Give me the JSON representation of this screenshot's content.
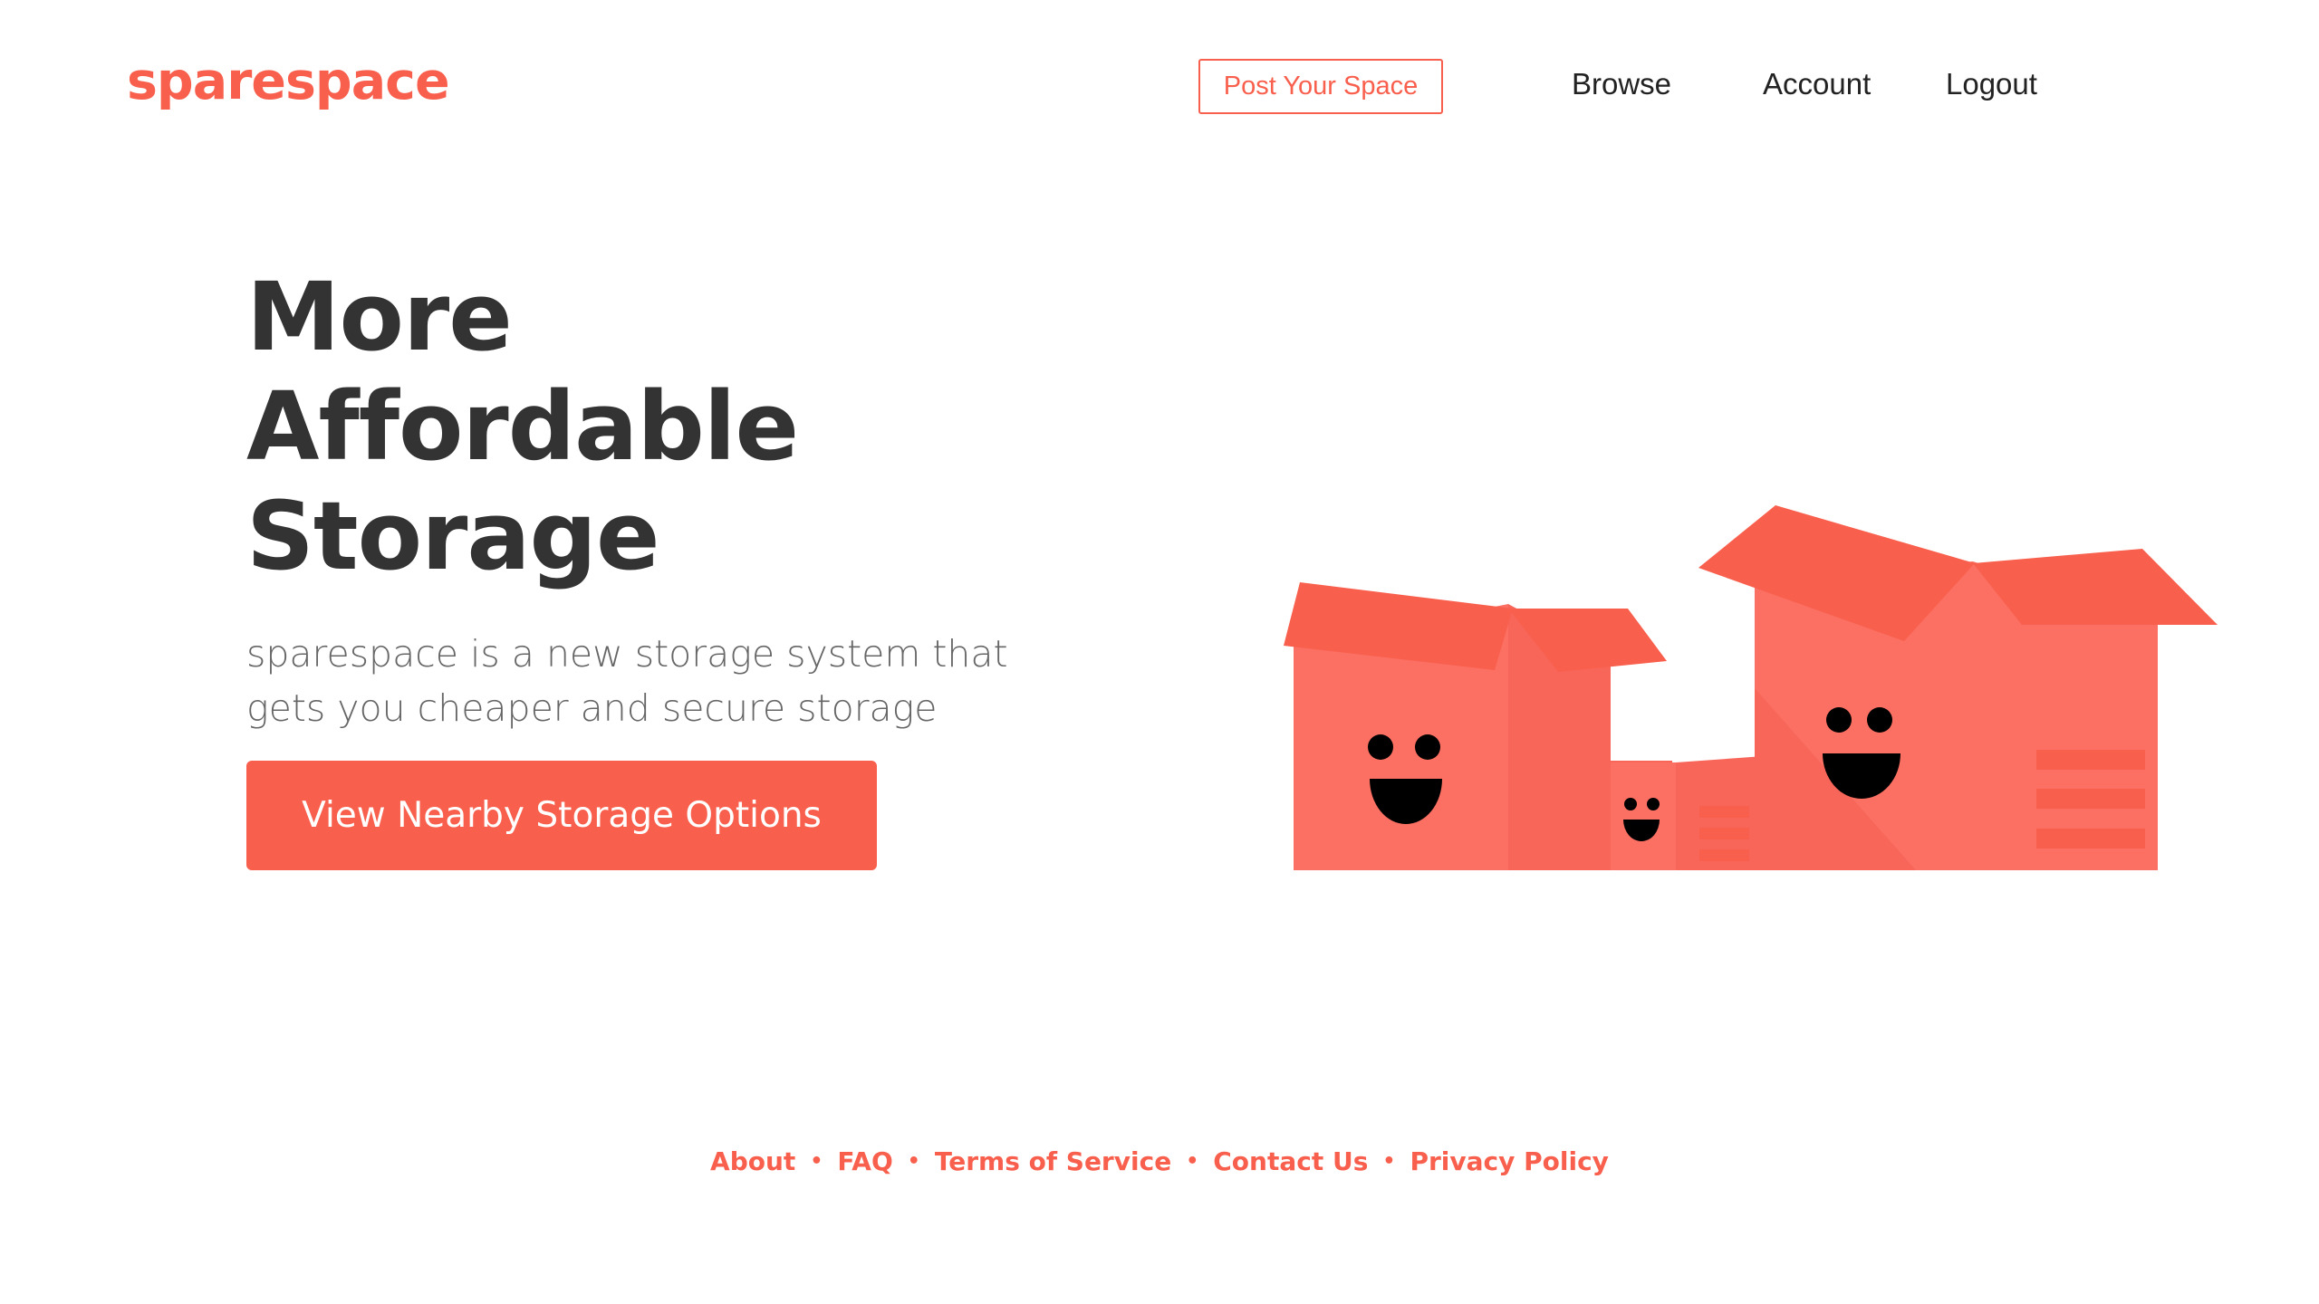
{
  "brand": {
    "name": "sparespace",
    "accent_color": "#f95f4d",
    "text_dark": "#333333"
  },
  "nav": {
    "post_label": "Post Your Space",
    "items": [
      {
        "label": "Browse"
      },
      {
        "label": "Account"
      },
      {
        "label": "Logout"
      }
    ]
  },
  "hero": {
    "headline_lines": [
      "More",
      "Affordable",
      "Storage"
    ],
    "subtext_lines": [
      "sparespace is a new storage system that",
      "gets you cheaper and secure storage"
    ],
    "cta_label": "View Nearby Storage Options",
    "illustration": "happy-storage-boxes-illustration"
  },
  "footer": {
    "separator": "•",
    "links": [
      {
        "label": "About"
      },
      {
        "label": "FAQ"
      },
      {
        "label": "Terms of Service"
      },
      {
        "label": "Contact Us"
      },
      {
        "label": "Privacy Policy"
      }
    ]
  }
}
